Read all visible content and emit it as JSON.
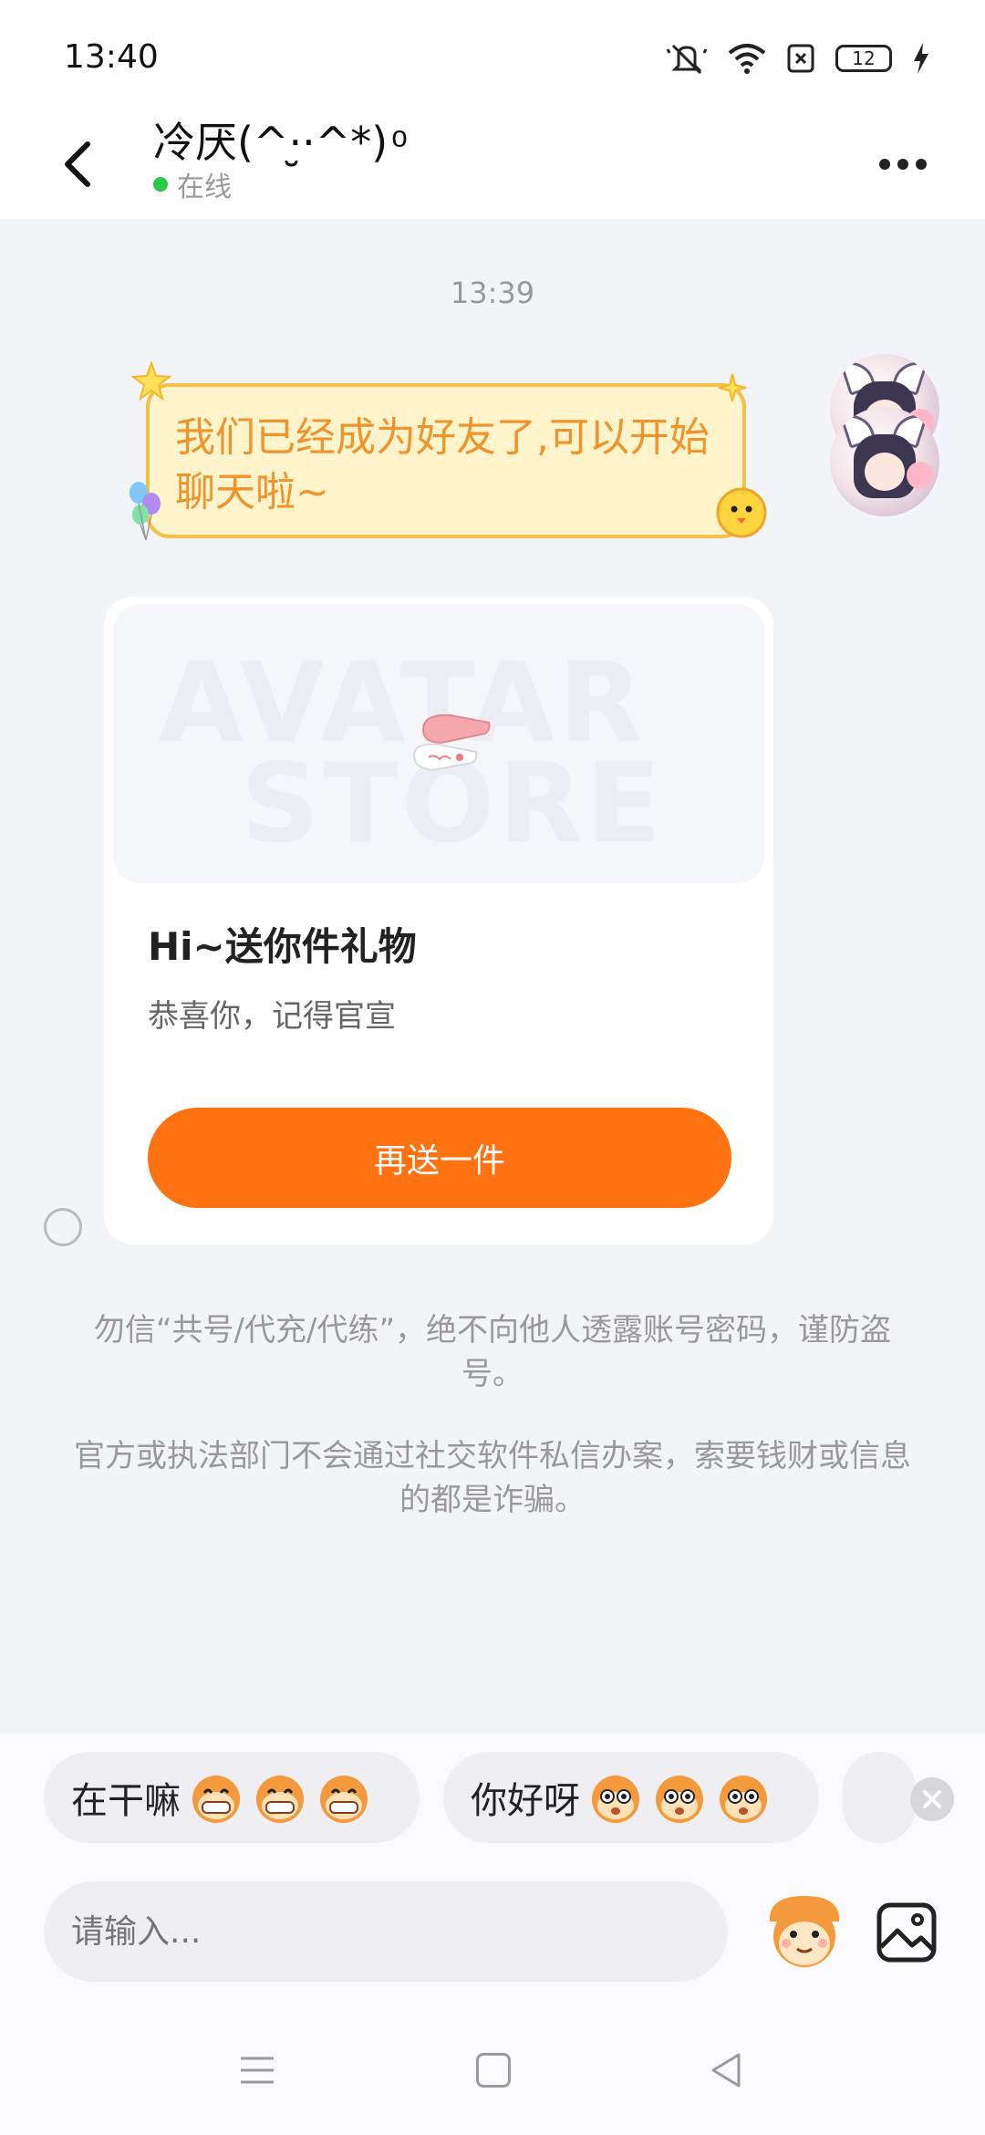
{
  "status_bar": {
    "time": "13:40",
    "battery": "12",
    "icons": [
      "mute-icon",
      "wifi-icon",
      "no-sim-icon",
      "battery-icon",
      "charging-icon"
    ]
  },
  "header": {
    "title": "冷厌(^·̮·^*) ͦ",
    "status": "在线",
    "status_color": "#2bc84a"
  },
  "chat": {
    "timestamp": "13:39",
    "system_bubble": "我们已经成为好友了,可以开始聊天啦~",
    "gift_card": {
      "watermark_line1": "AVATAR",
      "watermark_line2": "STORE",
      "title": "Hi~送你件礼物",
      "subtitle": "恭喜你，记得官宣",
      "button": "再送一件",
      "button_color": "#ff7212"
    },
    "notices": [
      "勿信“共号/代充/代练”，绝不向他人透露账号密码，谨防盗号。",
      "官方或执法部门不会通过社交软件私信办案，索要钱财或信息的都是诈骗。"
    ]
  },
  "quick_replies": [
    {
      "label": "在干嘛",
      "emoji_icon": "grin-monkey-icon"
    },
    {
      "label": "你好呀",
      "emoji_icon": "surprised-monkey-icon"
    }
  ],
  "input": {
    "placeholder": "请输入..."
  }
}
